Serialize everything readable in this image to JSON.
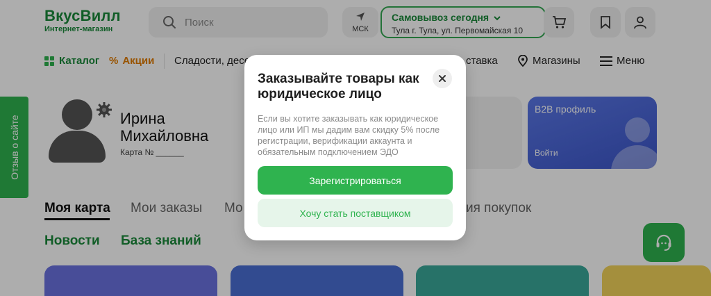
{
  "header": {
    "logo_name": "ВкусВилл",
    "logo_sub": "Интернет-магазин",
    "search_placeholder": "Поиск",
    "city_label": "МСК",
    "pickup_title": "Самовывоз сегодня",
    "pickup_address": "Тула г. Тула, ул. Первомайская 10"
  },
  "nav": {
    "catalog": "Каталог",
    "promo": "Акции",
    "sweets": "Сладости, десе",
    "delivery": "ставка",
    "stores": "Магазины",
    "menu": "Меню"
  },
  "feedback_tab": "Отзыв о сайте",
  "profile": {
    "name": "Ирина Михайловна",
    "card_label": "Карта №",
    "b2b_title": "B2B профиль",
    "b2b_action": "Войти"
  },
  "tabs": {
    "my_card": "Моя карта",
    "my_orders": "Мои заказы",
    "partial": "Мо",
    "purchases": "ия покупок",
    "news": "Новости",
    "knowledge": "База знаний"
  },
  "modal": {
    "title": "Заказывайте товары как юридическое лицо",
    "text": "Если вы хотите заказывать как юридическое лицо или ИП мы дадим вам скидку 5% после регистрации, верификации аккаунта и обязательным подключением ЭДО",
    "primary_button": "Зарегистрироваться",
    "secondary_button": "Хочу стать поставщиком"
  },
  "colors": {
    "brand_green": "#2fb34f",
    "dark_green": "#1a8a3a",
    "promo_orange": "#e07b00",
    "b2b_blue": "#4a66d8"
  }
}
